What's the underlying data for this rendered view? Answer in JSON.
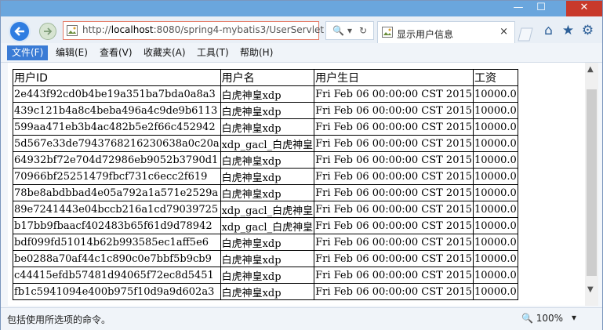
{
  "window": {
    "minimize_label": "—",
    "maximize_label": "☐",
    "close_label": "✕"
  },
  "address_bar": {
    "url_prefix": "http://",
    "url_host": "localhost",
    "url_rest": ":8080/spring4-mybatis3/UserServlet",
    "search_icon": "🔍",
    "dropdown_icon": "▾",
    "refresh_icon": "↻"
  },
  "tab": {
    "title": "显示用户信息",
    "close_label": "×"
  },
  "toolbar_icons": {
    "home": "⌂",
    "favorites": "★",
    "settings": "⚙"
  },
  "menu": {
    "items": [
      {
        "label": "文件(F)"
      },
      {
        "label": "编辑(E)"
      },
      {
        "label": "查看(V)"
      },
      {
        "label": "收藏夹(A)"
      },
      {
        "label": "工具(T)"
      },
      {
        "label": "帮助(H)"
      }
    ]
  },
  "table": {
    "headers": [
      "用户ID",
      "用户名",
      "用户生日",
      "工资"
    ],
    "rows": [
      [
        "2e443f92cd0b4be19a351ba7bda0a8a3",
        "白虎神皇xdp",
        "Fri Feb 06 00:00:00 CST 2015",
        "10000.0"
      ],
      [
        "439c121b4a8c4beba496a4c9de9b6113",
        "白虎神皇xdp",
        "Fri Feb 06 00:00:00 CST 2015",
        "10000.0"
      ],
      [
        "599aa471eb3b4ac482b5e2f66c452942",
        "白虎神皇xdp",
        "Fri Feb 06 00:00:00 CST 2015",
        "10000.0"
      ],
      [
        "5d567e33de7943768216230638a0c20a",
        "xdp_gacl_白虎神皇",
        "Fri Feb 06 00:00:00 CST 2015",
        "10000.0"
      ],
      [
        "64932bf72e704d72986eb9052b3790d1",
        "白虎神皇xdp",
        "Fri Feb 06 00:00:00 CST 2015",
        "10000.0"
      ],
      [
        "70966bf25251479fbcf731c6ecc2f619",
        "白虎神皇xdp",
        "Fri Feb 06 00:00:00 CST 2015",
        "10000.0"
      ],
      [
        "78be8abdbbad4e05a792a1a571e2529a",
        "白虎神皇xdp",
        "Fri Feb 06 00:00:00 CST 2015",
        "10000.0"
      ],
      [
        "89e7241443e04bccb216a1cd79039725",
        "xdp_gacl_白虎神皇",
        "Fri Feb 06 00:00:00 CST 2015",
        "10000.0"
      ],
      [
        "b17bb9fbaacf402483b65f61d9d78942",
        "xdp_gacl_白虎神皇",
        "Fri Feb 06 00:00:00 CST 2015",
        "10000.0"
      ],
      [
        "bdf099fd51014b62b993585ec1aff5e6",
        "白虎神皇xdp",
        "Fri Feb 06 00:00:00 CST 2015",
        "10000.0"
      ],
      [
        "be0288a70af44c1c890c0e7bbf5b9cb9",
        "白虎神皇xdp",
        "Fri Feb 06 00:00:00 CST 2015",
        "10000.0"
      ],
      [
        "c44415efdb57481d94065f72ec8d5451",
        "白虎神皇xdp",
        "Fri Feb 06 00:00:00 CST 2015",
        "10000.0"
      ],
      [
        "fb1c5941094e400b975f10d9a9d602a3",
        "白虎神皇xdp",
        "Fri Feb 06 00:00:00 CST 2015",
        "10000.0"
      ]
    ]
  },
  "status": {
    "message": "包括使用所选项的命令。",
    "zoom": "100%",
    "zoom_dropdown": "▾"
  }
}
